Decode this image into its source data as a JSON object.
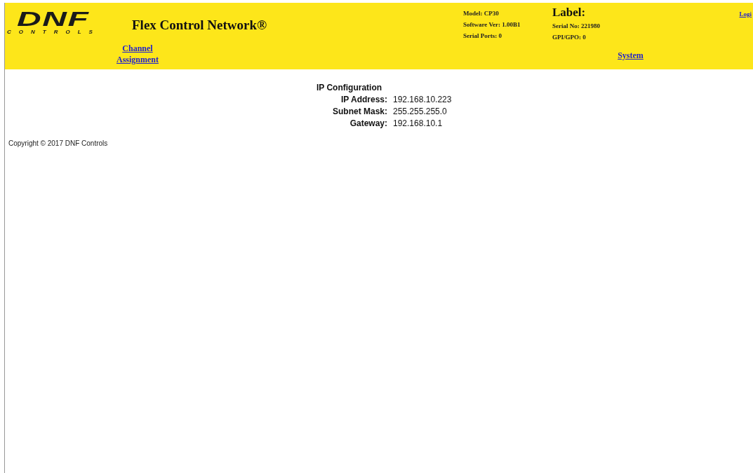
{
  "header": {
    "logo": {
      "mark": "DNF",
      "tagline": "CONTROLS"
    },
    "title": "Flex Control Network®",
    "info_left": [
      "Model: CP30",
      "Software Ver: 1.00B1",
      "Serial Ports: 0"
    ],
    "label": "Label:",
    "info_right": [
      "Serial No: 221980",
      "GPI/GPO: 0"
    ],
    "login": "Logi",
    "nav": [
      {
        "label": "Channel Assignment"
      },
      {
        "label": "System"
      }
    ]
  },
  "ip_configuration": {
    "title": "IP Configuration",
    "rows": [
      {
        "label": "IP Address:",
        "value": "192.168.10.223"
      },
      {
        "label": "Subnet Mask:",
        "value": "255.255.255.0"
      },
      {
        "label": "Gateway:",
        "value": "192.168.10.1"
      }
    ]
  },
  "footer": "Copyright © 2017 DNF Controls"
}
